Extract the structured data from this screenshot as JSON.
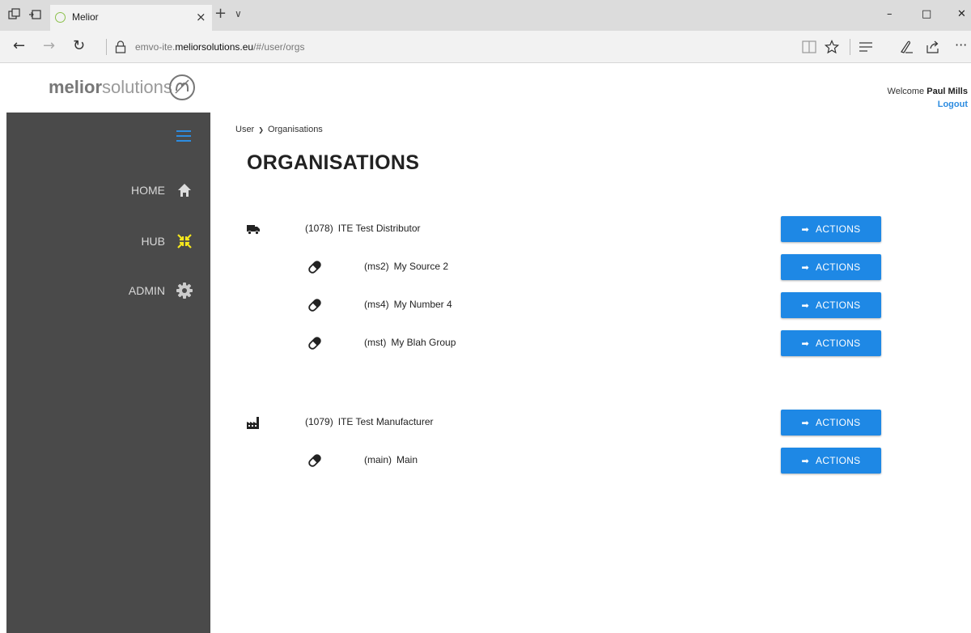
{
  "browser": {
    "tab_title": "Melior",
    "tab_close": "×",
    "new_tab": "+",
    "tab_list": "∨",
    "win_minimize": "–",
    "win_maximize": "□",
    "win_close": "✕",
    "nav_back": "←",
    "nav_forward": "→",
    "nav_refresh": "↻",
    "url_prefix": "emvo-ite.",
    "url_domain": "meliorsolutions.eu",
    "url_path": "/#/user/orgs",
    "more": "···"
  },
  "logo": {
    "strong": "melior",
    "light": "solutions"
  },
  "sidebar": {
    "items": [
      {
        "label": "HOME",
        "icon": "home-icon",
        "color": "#dddddd"
      },
      {
        "label": "HUB",
        "icon": "hub-icon",
        "color": "#f5e71c"
      },
      {
        "label": "ADMIN",
        "icon": "gear-icon",
        "color": "#cccccc"
      }
    ]
  },
  "header": {
    "welcome_prefix": "Welcome",
    "user_name": "Paul Mills",
    "logout": "Logout"
  },
  "breadcrumb": {
    "parent": "User",
    "separator": "❯",
    "current": "Organisations"
  },
  "page_title": "ORGANISATIONS",
  "action_label": "ACTIONS",
  "action_arrow": "➡",
  "accent_color": "#1e88e5",
  "organisations": [
    {
      "code": "(1078)",
      "name": "ITE Test Distributor",
      "icon": "truck-icon",
      "level": "parent"
    },
    {
      "code": "(ms2)",
      "name": "My Source 2",
      "icon": "pill-icon",
      "level": "child"
    },
    {
      "code": "(ms4)",
      "name": "My Number 4",
      "icon": "pill-icon",
      "level": "child"
    },
    {
      "code": "(mst)",
      "name": "My Blah Group",
      "icon": "pill-icon",
      "level": "child"
    },
    {
      "code": "(1079)",
      "name": "ITE Test Manufacturer",
      "icon": "factory-icon",
      "level": "parent"
    },
    {
      "code": "(main)",
      "name": "Main",
      "icon": "pill-icon",
      "level": "child"
    }
  ]
}
